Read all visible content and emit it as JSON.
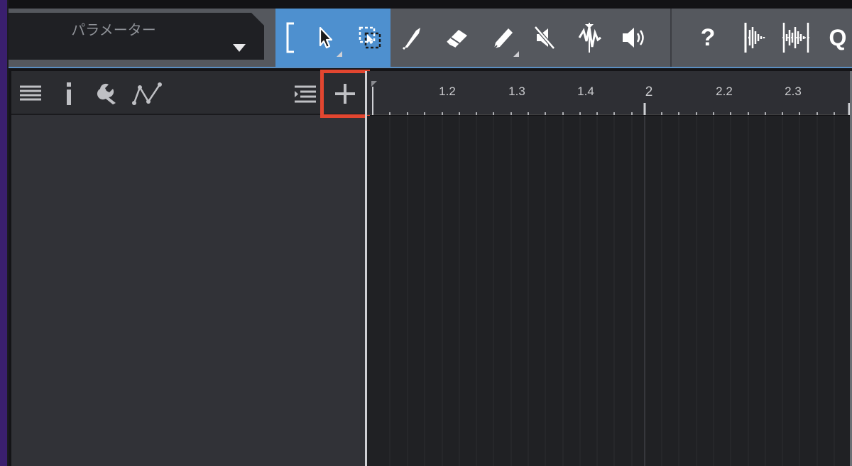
{
  "parameter_selector": {
    "label": "パラメーター",
    "icon": "dropdown-triangle-icon"
  },
  "toolbar": {
    "tools": [
      {
        "id": "range-bracket",
        "icon": "bracket-icon",
        "active": true
      },
      {
        "id": "arrow-tool",
        "icon": "arrow-cursor-icon",
        "active": true
      },
      {
        "id": "range-select-tool",
        "icon": "range-select-icon",
        "active": true
      },
      {
        "id": "knife-tool",
        "icon": "knife-icon",
        "active": false
      },
      {
        "id": "eraser-tool",
        "icon": "eraser-icon",
        "active": false
      },
      {
        "id": "pencil-tool",
        "icon": "pencil-icon",
        "active": false
      },
      {
        "id": "mute-tool",
        "icon": "mute-icon",
        "active": false
      },
      {
        "id": "bend-tool",
        "icon": "waveform-bend-icon",
        "active": false
      },
      {
        "id": "listen-tool",
        "icon": "speaker-icon",
        "active": false
      },
      {
        "id": "help",
        "icon": "help-icon",
        "label": "?"
      },
      {
        "id": "snap-waveform",
        "icon": "waveform-snap-icon"
      },
      {
        "id": "snap-waveform-grid",
        "icon": "waveform-grid-icon"
      },
      {
        "id": "quantize",
        "icon": "quantize-icon",
        "label": "Q"
      }
    ]
  },
  "left_panel_header": {
    "icons": [
      "list-icon",
      "info-icon",
      "wrench-icon",
      "automation-curve-icon",
      "indent-list-icon",
      "add-icon"
    ],
    "add_label": "+",
    "highlight_color": "#e24630"
  },
  "ruler": {
    "labels": [
      "1.2",
      "1.3",
      "1.4",
      "2",
      "2.2",
      "2.3"
    ]
  },
  "colors": {
    "accent_active": "#4e90cf",
    "toolbar_bg": "#55585e",
    "highlight": "#e24630"
  }
}
